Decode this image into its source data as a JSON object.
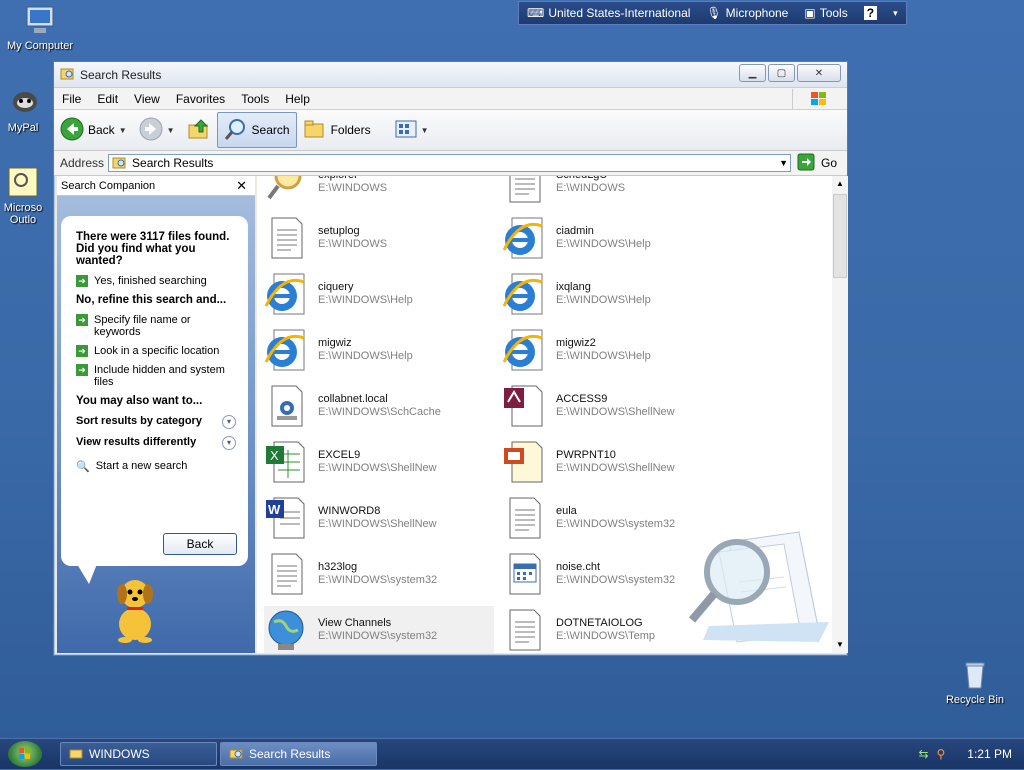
{
  "desktop": {
    "icons": [
      {
        "label": "My Computer"
      },
      {
        "label": "MyPal"
      },
      {
        "label": "Microso Outlo"
      },
      {
        "label": "Recycle Bin"
      }
    ]
  },
  "langbar": {
    "language": "United States-International",
    "microphone": "Microphone",
    "tools": "Tools",
    "help": "?"
  },
  "window": {
    "title": "Search Results",
    "menu": [
      "File",
      "Edit",
      "View",
      "Favorites",
      "Tools",
      "Help"
    ],
    "toolbar": {
      "back": "Back",
      "search": "Search",
      "folders": "Folders"
    },
    "address": {
      "label": "Address",
      "value": "Search Results",
      "go": "Go"
    }
  },
  "companion": {
    "header": "Search Companion",
    "found_text": "There were 3117 files found. Did you find what you wanted?",
    "yes_option": "Yes, finished searching",
    "refine_heading": "No, refine this search and...",
    "refine_options": [
      "Specify file name or keywords",
      "Look in a specific location",
      "Include hidden and system files"
    ],
    "also_heading": "You may also want to...",
    "sort_results": "Sort results by category",
    "view_results": "View results differently",
    "new_search": "Start a new search",
    "back_button": "Back"
  },
  "results": {
    "items": [
      {
        "name": "explorer",
        "path": "E:\\WINDOWS",
        "icon": "search-magnifier-icon"
      },
      {
        "name": "SchedLgU",
        "path": "E:\\WINDOWS",
        "icon": "text-file-icon"
      },
      {
        "name": "setuplog",
        "path": "E:\\WINDOWS",
        "icon": "text-file-icon"
      },
      {
        "name": "ciadmin",
        "path": "E:\\WINDOWS\\Help",
        "icon": "ie-icon"
      },
      {
        "name": "ciquery",
        "path": "E:\\WINDOWS\\Help",
        "icon": "ie-icon"
      },
      {
        "name": "ixqlang",
        "path": "E:\\WINDOWS\\Help",
        "icon": "ie-icon"
      },
      {
        "name": "migwiz",
        "path": "E:\\WINDOWS\\Help",
        "icon": "ie-icon"
      },
      {
        "name": "migwiz2",
        "path": "E:\\WINDOWS\\Help",
        "icon": "ie-icon"
      },
      {
        "name": "collabnet.local",
        "path": "E:\\WINDOWS\\SchCache",
        "icon": "settings-file-icon"
      },
      {
        "name": "ACCESS9",
        "path": "E:\\WINDOWS\\ShellNew",
        "icon": "access-icon"
      },
      {
        "name": "EXCEL9",
        "path": "E:\\WINDOWS\\ShellNew",
        "icon": "excel-icon"
      },
      {
        "name": "PWRPNT10",
        "path": "E:\\WINDOWS\\ShellNew",
        "icon": "powerpoint-icon"
      },
      {
        "name": "WINWORD8",
        "path": "E:\\WINDOWS\\ShellNew",
        "icon": "word-icon"
      },
      {
        "name": "eula",
        "path": "E:\\WINDOWS\\system32",
        "icon": "text-file-icon"
      },
      {
        "name": "h323log",
        "path": "E:\\WINDOWS\\system32",
        "icon": "text-file-icon"
      },
      {
        "name": "noise.cht",
        "path": "E:\\WINDOWS\\system32",
        "icon": "calendar-file-icon"
      },
      {
        "name": "View Channels",
        "path": "E:\\WINDOWS\\system32",
        "icon": "globe-icon"
      },
      {
        "name": "DOTNETAIOLOG",
        "path": "E:\\WINDOWS\\Temp",
        "icon": "text-file-icon"
      }
    ]
  },
  "taskbar": {
    "tasks": [
      {
        "label": "WINDOWS"
      },
      {
        "label": "Search Results"
      }
    ],
    "clock": "1:21 PM"
  }
}
